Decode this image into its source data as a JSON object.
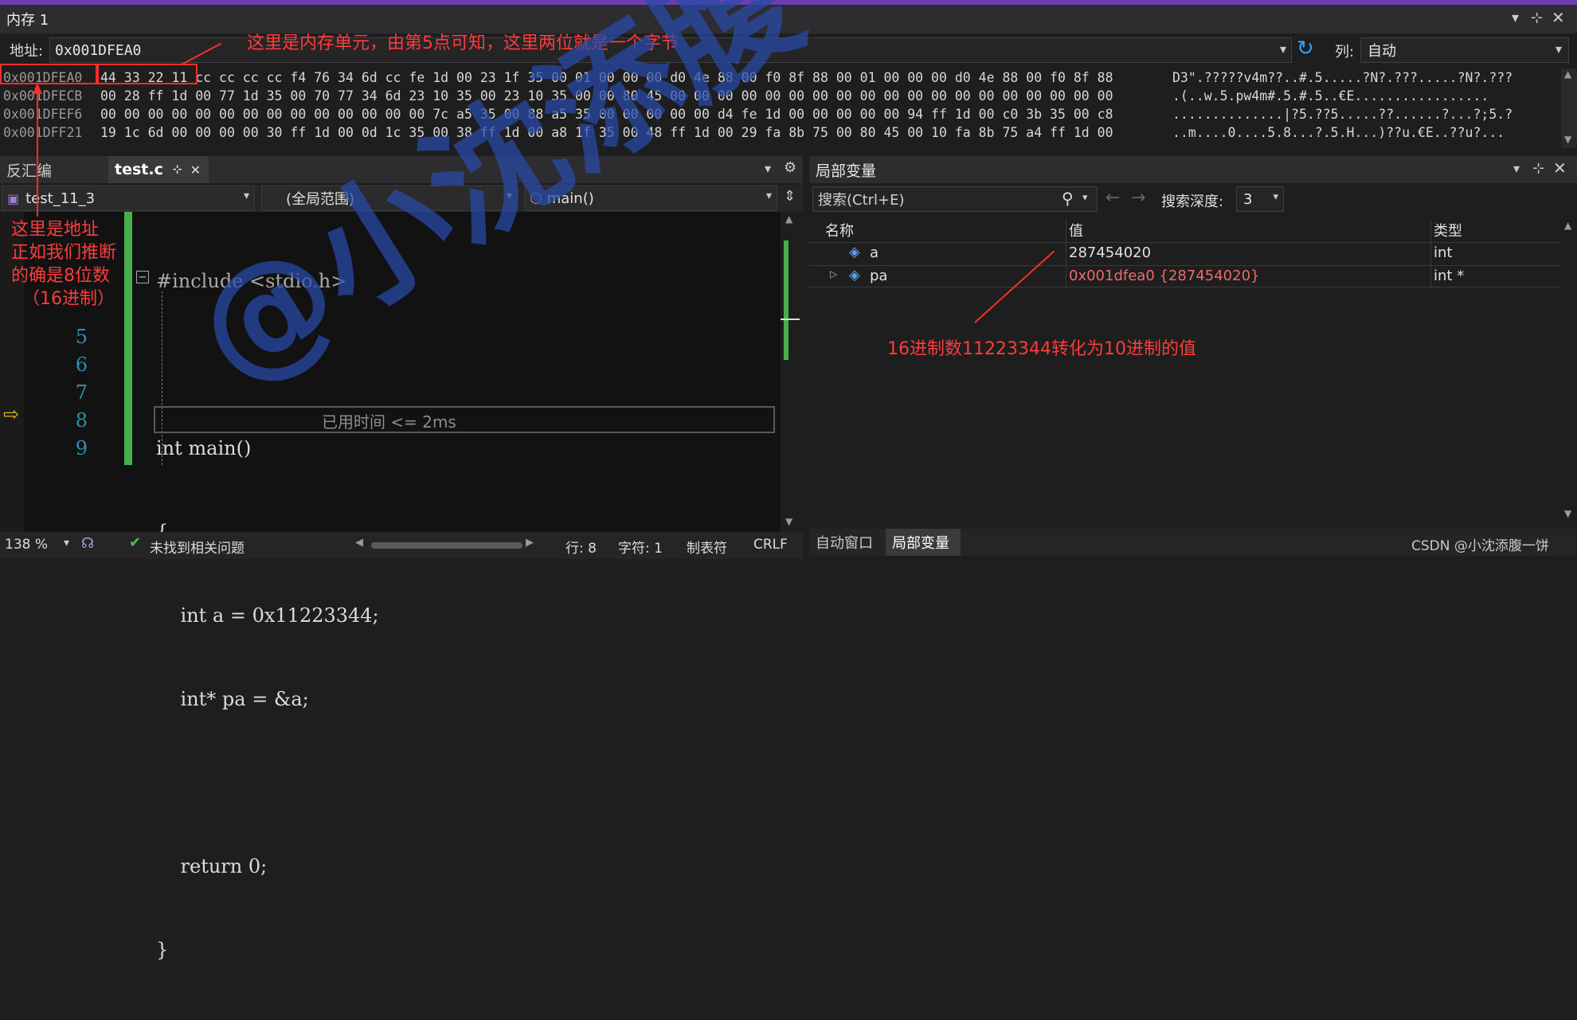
{
  "memory_window": {
    "title": "内存 1",
    "address_label": "地址:",
    "address_value": "0x001DFEA0",
    "columns_label": "列:",
    "columns_value": "自动",
    "rows": [
      {
        "address": "0x001DFEA0",
        "bytes": "44 33 22 11 cc cc cc cc f4 76 34 6d cc fe 1d 00 23 1f 35 00 01 00 00 00 d0 4e 88 00 f0 8f 88 00 01 00 00 00 d0 4e 88 00 f0 8f 88",
        "ascii": "D3\".?????v4m??..#.5.....?N?.???.....?N?.???"
      },
      {
        "address": "0x001DFECB",
        "bytes": "00 28 ff 1d 00 77 1d 35 00 70 77 34 6d 23 10 35 00 23 10 35 00 00 80 45 00 00 00 00 00 00 00 00 00 00 00 00 00 00 00 00 00 00 00",
        "ascii": ".(..w.5.pw4m#.5.#.5..€E................."
      },
      {
        "address": "0x001DFEF6",
        "bytes": "00 00 00 00 00 00 00 00 00 00 00 00 00 00 7c a5 35 00 88 a5 35 00 00 00 00 00 d4 fe 1d 00 00 00 00 00 94 ff 1d 00 c0 3b 35 00 c8",
        "ascii": "..............|?5.??5.....??......?...?;5.?"
      },
      {
        "address": "0x001DFF21",
        "bytes": "19 1c 6d 00 00 00 00 30 ff 1d 00 0d 1c 35 00 38 ff 1d 00 a8 1f 35 00 48 ff 1d 00 29 fa 8b 75 00 80 45 00 10 fa 8b 75 a4 ff 1d 00",
        "ascii": "..m....0....5.8...?.5.H...)??u.€E..??u?..."
      }
    ]
  },
  "editor": {
    "tabs": [
      {
        "label": "反汇编",
        "active": false
      },
      {
        "label": "test.c",
        "active": true
      }
    ],
    "tab_pin_glyph": "⊹",
    "tab_close_glyph": "✕",
    "project_select": "test_11_3",
    "scope_select": "(全局范围)",
    "function_select": "main()",
    "lines": [
      {
        "num": "",
        "code": "#include <stdio.h>"
      },
      {
        "num": "",
        "code": ""
      },
      {
        "num": "",
        "code": "int main()"
      },
      {
        "num": "",
        "code": "{"
      },
      {
        "num": "5",
        "code": "    int a = 0x11223344;"
      },
      {
        "num": "6",
        "code": "    int* pa = &a;"
      },
      {
        "num": "7",
        "code": ""
      },
      {
        "num": "8",
        "code": "    return 0;"
      },
      {
        "num": "9",
        "code": "}"
      }
    ],
    "elapsed_hint": "已用时间 <= 2ms"
  },
  "locals": {
    "title": "局部变量",
    "search_placeholder": "搜索(Ctrl+E)",
    "search_depth_label": "搜索深度:",
    "search_depth_value": "3",
    "headers": {
      "name": "名称",
      "value": "值",
      "type": "类型"
    },
    "rows": [
      {
        "name": "a",
        "value": "287454020",
        "type": "int",
        "value_color": "#dcdcdc"
      },
      {
        "name": "pa",
        "value": "0x001dfea0 {287454020}",
        "type": "int *",
        "value_color": "#f06a6a"
      }
    ]
  },
  "status_bar": {
    "zoom": "138 %",
    "issues": "未找到相关问题",
    "line": "行: 8",
    "char": "字符: 1",
    "tab_mode": "制表符",
    "line_ending": "CRLF"
  },
  "bottom_tabs": [
    {
      "label": "自动窗口",
      "active": false
    },
    {
      "label": "局部变量",
      "active": true
    }
  ],
  "annotations": {
    "memory_unit": "这里是内存单元，由第5点可知，这里两位就是一个字节",
    "address_note_line1": "这里是地址",
    "address_note_line2": "正如我们推断",
    "address_note_line3": "的确是8位数",
    "address_note_line4": "（16进制）",
    "hex_to_dec": "16进制数11223344转化为10进制的值"
  },
  "watermark": {
    "text_main": "@小沈添腹一饼",
    "credit": "CSDN @小沈添腹一饼"
  },
  "colors": {
    "accent_blue": "#3b7fd1",
    "annotation_red": "#ff2d2d",
    "watermark_blue": "#284baa"
  }
}
